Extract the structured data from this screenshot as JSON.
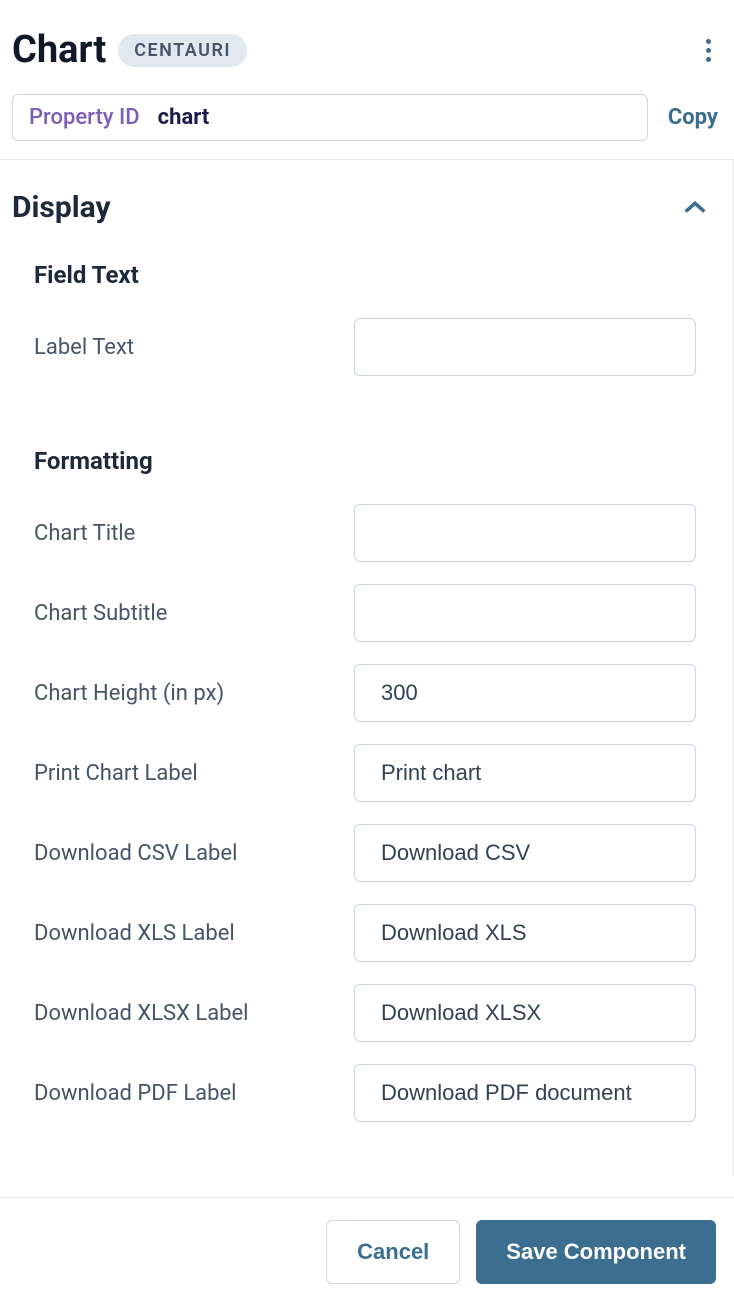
{
  "header": {
    "title": "Chart",
    "badge": "CENTAURI",
    "propertyIdLabel": "Property ID",
    "propertyIdValue": "chart",
    "copyLabel": "Copy"
  },
  "section": {
    "title": "Display"
  },
  "fieldText": {
    "heading": "Field Text",
    "labelText": {
      "label": "Label Text",
      "value": ""
    }
  },
  "formatting": {
    "heading": "Formatting",
    "chartTitle": {
      "label": "Chart Title",
      "value": ""
    },
    "chartSubtitle": {
      "label": "Chart Subtitle",
      "value": ""
    },
    "chartHeight": {
      "label": "Chart Height (in px)",
      "value": "300"
    },
    "printChart": {
      "label": "Print Chart Label",
      "value": "Print chart"
    },
    "downloadCsv": {
      "label": "Download CSV Label",
      "value": "Download CSV"
    },
    "downloadXls": {
      "label": "Download XLS Label",
      "value": "Download XLS"
    },
    "downloadXlsx": {
      "label": "Download XLSX Label",
      "value": "Download XLSX"
    },
    "downloadPdf": {
      "label": "Download PDF Label",
      "value": "Download PDF document"
    }
  },
  "footer": {
    "cancel": "Cancel",
    "save": "Save Component"
  }
}
